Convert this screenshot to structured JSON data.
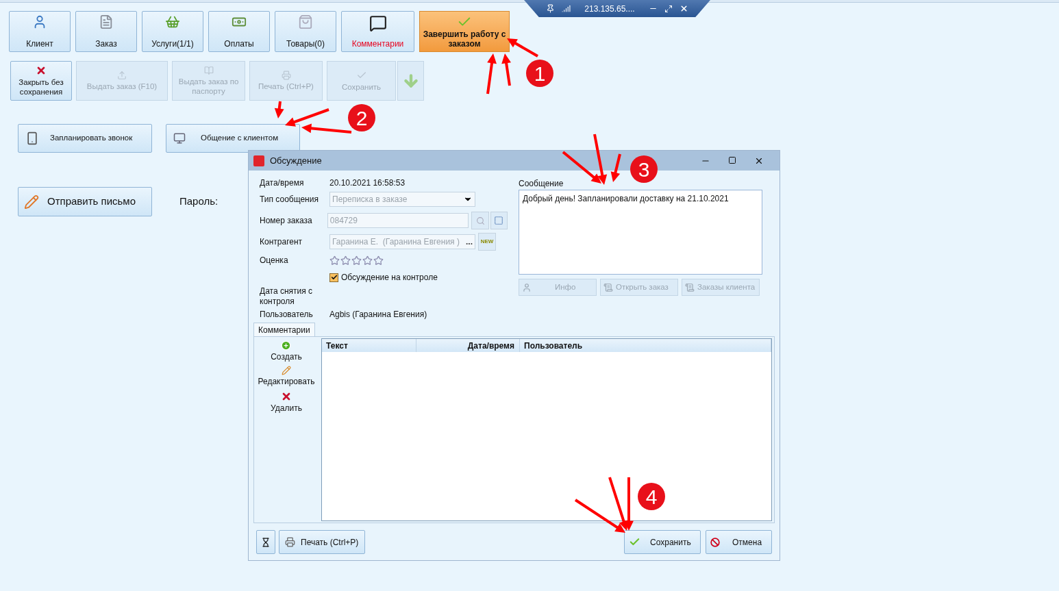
{
  "remote_bar": {
    "address": "213.135.65...."
  },
  "main_toolbar": [
    {
      "label": "Клиент",
      "kind": "normal"
    },
    {
      "label": "Заказ",
      "kind": "normal"
    },
    {
      "label": "Услуги(1/1)",
      "kind": "normal"
    },
    {
      "label": "Оплаты",
      "kind": "normal"
    },
    {
      "label": "Товары(0)",
      "kind": "normal"
    },
    {
      "label": "Комментарии",
      "kind": "alert"
    },
    {
      "label": "Завершить работу с заказом",
      "kind": "primary"
    }
  ],
  "action_toolbar": [
    {
      "label": "Закрыть без сохранения",
      "disabled": false
    },
    {
      "label": "Выдать заказ (F10)",
      "disabled": true
    },
    {
      "label": "Выдать заказ по паспорту",
      "disabled": true
    },
    {
      "label": "Печать (Ctrl+P)",
      "disabled": true
    },
    {
      "label": "Сохранить",
      "disabled": true
    }
  ],
  "contact_buttons": [
    "Запланировать звонок",
    "Общение с клиентом"
  ],
  "mail_button": "Отправить письмо",
  "password_label": "Пароль:",
  "dialog": {
    "title": "Обсуждение",
    "datetime_label": "Дата/время",
    "datetime": "20.10.2021 16:58:53",
    "type_label": "Тип сообщения",
    "type_value": "Переписка в заказе",
    "order_label": "Номер заказа",
    "order_value": "084729",
    "contractor_label": "Контрагент",
    "contractor_value": "Гаранина Е.  (Гаранина Евгения )",
    "contractor_more": "...",
    "new_badge": "NEW",
    "rating_label": "Оценка",
    "stars": 0,
    "control_checkbox": {
      "label": "Обсуждение на контроле",
      "checked": true
    },
    "removal_label": "Дата снятия с контроля",
    "user_label": "Пользователь",
    "user_value": "Agbis (Гаранина Евгения)",
    "message_label": "Сообщение",
    "message": "Добрый день! Запланировали доставку на 21.10.2021",
    "info_buttons": [
      {
        "label": "Инфо",
        "disabled": true
      },
      {
        "label": "Открыть заказ",
        "disabled": true
      },
      {
        "label": "Заказы клиента",
        "disabled": true
      }
    ],
    "tabs": [
      {
        "label": "Комментарии",
        "selected": true
      }
    ],
    "comment_actions": [
      {
        "label": "Создать",
        "kind": "add"
      },
      {
        "label": "Редактировать",
        "kind": "edit"
      },
      {
        "label": "Удалить",
        "kind": "delete"
      }
    ],
    "table": {
      "columns": [
        "Текст",
        "Дата/время",
        "Пользователь"
      ]
    },
    "print_button": "Печать (Ctrl+P)",
    "save_button": "Сохранить",
    "cancel_button": "Отмена"
  },
  "annotations": [
    {
      "number": "1"
    },
    {
      "number": "2"
    },
    {
      "number": "3"
    },
    {
      "number": "4"
    }
  ]
}
